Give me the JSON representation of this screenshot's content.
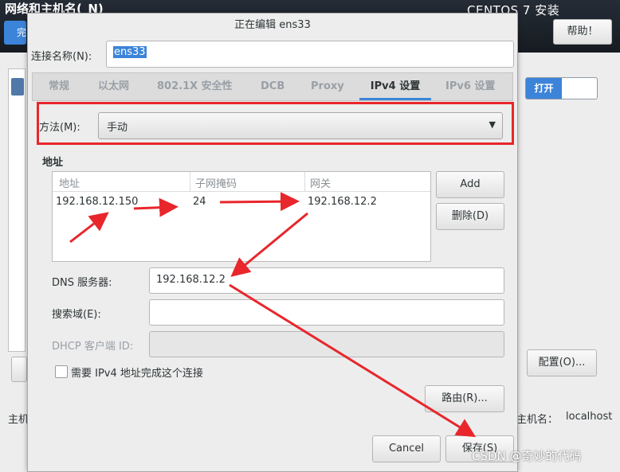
{
  "background": {
    "title": "网络和主机名(_N)",
    "os_title": "CENTOS 7 安装",
    "done_label": "完",
    "help_label": "帮助！",
    "toggle_label": "打开",
    "config_label": "配置(O)...",
    "minus_label": "-",
    "host_left_label": "主机",
    "host_label": "主机名：",
    "host_value": "localhost"
  },
  "dialog": {
    "title": "正在编辑 ens33",
    "connection_label": "连接名称(N):",
    "connection_value": "ens33",
    "tabs": [
      {
        "label": "常规"
      },
      {
        "label": "以太网"
      },
      {
        "label": "802.1X 安全性"
      },
      {
        "label": "DCB"
      },
      {
        "label": "Proxy"
      },
      {
        "label": "IPv4 设置"
      },
      {
        "label": "IPv6 设置"
      }
    ],
    "active_tab": "IPv4 设置",
    "method_label": "方法(M):",
    "method_value": "手动",
    "address_section": "地址",
    "table": {
      "columns": [
        "地址",
        "子网掩码",
        "网关"
      ],
      "rows": [
        {
          "address": "192.168.12.150",
          "netmask": "24",
          "gateway": "192.168.12.2"
        }
      ]
    },
    "add_label": "Add",
    "delete_label": "删除(D)",
    "dns_label": "DNS 服务器:",
    "dns_value": "192.168.12.2",
    "search_label": "搜索域(E):",
    "search_value": "",
    "dhcp_label": "DHCP 客户端 ID:",
    "dhcp_value": "",
    "require_label": "需要 IPv4 地址完成这个连接",
    "routes_label": "路由(R)...",
    "cancel_label": "Cancel",
    "save_label": "保存(S)"
  },
  "watermark": "CSDN @奇妙的代码",
  "colors": {
    "accent": "#3c84d9",
    "annotation_red": "#e8262c"
  }
}
